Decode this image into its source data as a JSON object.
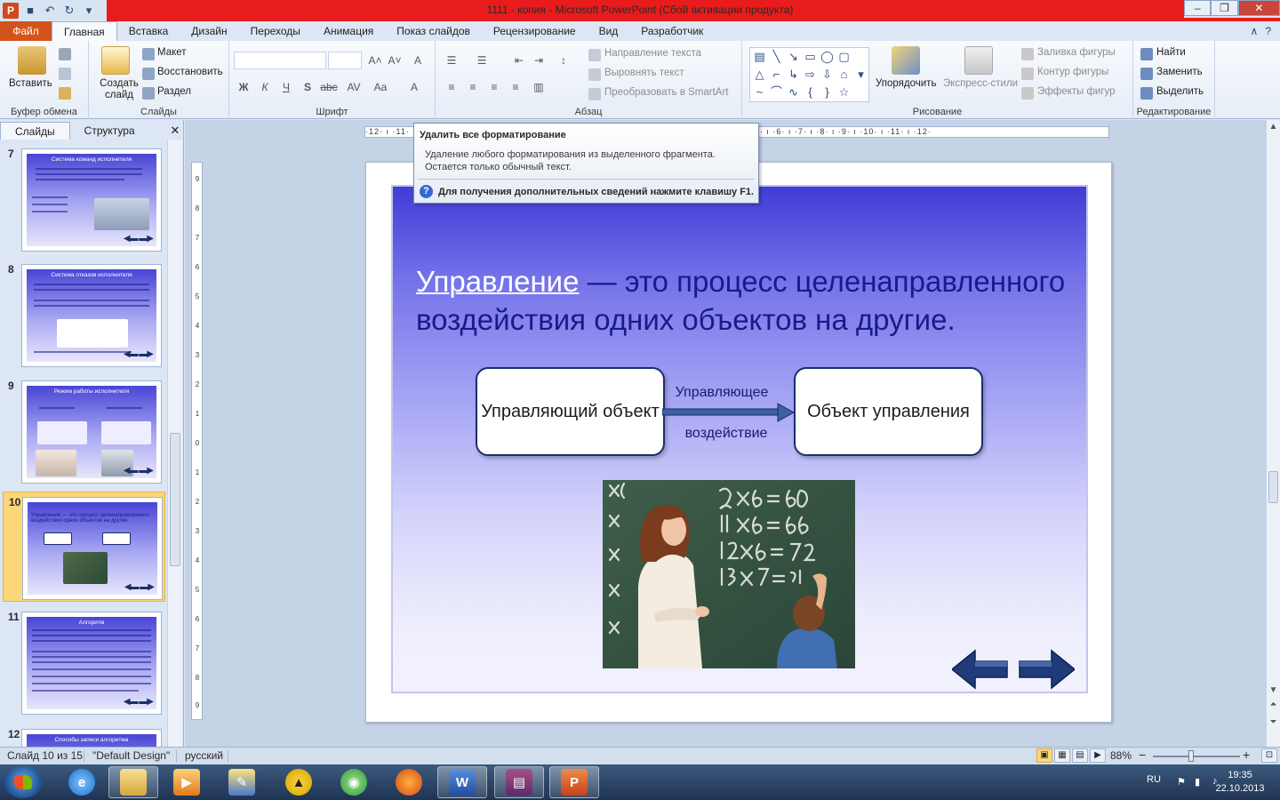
{
  "window": {
    "title": "1111 - копия  -  Microsoft PowerPoint (Сбой активации продукта)",
    "minimize": "–",
    "maximize": "❐",
    "close": "✕"
  },
  "qat": {
    "app": "P",
    "save": "💾",
    "undo": "↶",
    "redo": "↻",
    "more": "▾"
  },
  "tabs": [
    {
      "label": "Файл"
    },
    {
      "label": "Главная"
    },
    {
      "label": "Вставка"
    },
    {
      "label": "Дизайн"
    },
    {
      "label": "Переходы"
    },
    {
      "label": "Анимация"
    },
    {
      "label": "Показ слайдов"
    },
    {
      "label": "Рецензирование"
    },
    {
      "label": "Вид"
    },
    {
      "label": "Разработчик"
    }
  ],
  "ribbon": {
    "clipboard": {
      "paste": "Вставить",
      "group": "Буфер обмена"
    },
    "slides": {
      "new_slide": "Создать слайд",
      "layout": "Макет",
      "reset": "Восстановить",
      "section": "Раздел",
      "group": "Слайды"
    },
    "font": {
      "group": "Шрифт",
      "bold": "Ж",
      "italic": "К",
      "underline": "Ч",
      "shadow": "S",
      "strike": "abc",
      "spacing": "AV",
      "case": "Aa",
      "color": "A",
      "grow": "A˄",
      "shrink": "A˅",
      "clear": "A"
    },
    "paragraph": {
      "group": "Абзац",
      "text_direction": "Направление текста",
      "align_text": "Выровнять текст",
      "smartart": "Преобразовать в SmartArt"
    },
    "drawing": {
      "group": "Рисование",
      "arrange": "Упорядочить",
      "quick_styles": "Экспресс-стили",
      "fill": "Заливка фигуры",
      "outline": "Контур фигуры",
      "effects": "Эффекты фигур"
    },
    "editing": {
      "group": "Редактирование",
      "find": "Найти",
      "replace": "Заменить",
      "select": "Выделить"
    }
  },
  "tooltip": {
    "title": "Удалить все форматирование",
    "line1": "Удаление любого форматирования из выделенного фрагмента.",
    "line2": "Остается только обычный текст.",
    "help": "Для получения дополнительных сведений нажмите клавишу F1."
  },
  "left_pane": {
    "tab_slides": "Слайды",
    "tab_outline": "Структура",
    "close": "✕",
    "thumbnails": [
      {
        "num": "7",
        "title": "Система команд исполнителя"
      },
      {
        "num": "8",
        "title": "Система отказов исполнителя"
      },
      {
        "num": "9",
        "title": "Режим работы исполнителя"
      },
      {
        "num": "10",
        "title": "Управление — это процесс целенаправленного воздействия одних объектов на другие."
      },
      {
        "num": "11",
        "title": "Алгоритм"
      },
      {
        "num": "12",
        "title": "Способы записи алгоритма"
      }
    ]
  },
  "ruler": {
    "horizontal": "·12· ı ·11· ı ·10· ı ·9· ı ·8· ı ·7· ı ·6· ı ·5· ı ·4· ı ·3· ı ·2· ı ·1· ı ·0· ı ·1· ı ·2· ı ·3· ı ·4· ı ·5· ı ·6· ı ·7· ı ·8· ı ·9· ı ·10· ı ·11· ı ·12·",
    "vertical": [
      "9",
      "8",
      "7",
      "6",
      "5",
      "4",
      "3",
      "2",
      "1",
      "0",
      "1",
      "2",
      "3",
      "4",
      "5",
      "6",
      "7",
      "8",
      "9"
    ]
  },
  "slide": {
    "heading_link": "Управление",
    "heading_rest": " — это процесс целенаправленного воздействия одних объектов на другие.",
    "box_left": "Управляющий объект",
    "box_right": "Объект управления",
    "arrow_top": "Управляющее",
    "arrow_bottom": "воздействие",
    "nav_back": "back-arrow-icon",
    "nav_forward": "forward-arrow-icon"
  },
  "statusbar": {
    "slide_info": "Слайд 10 из 15",
    "theme": "\"Default Design\"",
    "language": "русский",
    "zoom": "88%",
    "zoom_out": "−",
    "zoom_in": "+"
  },
  "taskbar": {
    "lang": "RU",
    "time": "19:35",
    "date": "22.10.2013"
  }
}
